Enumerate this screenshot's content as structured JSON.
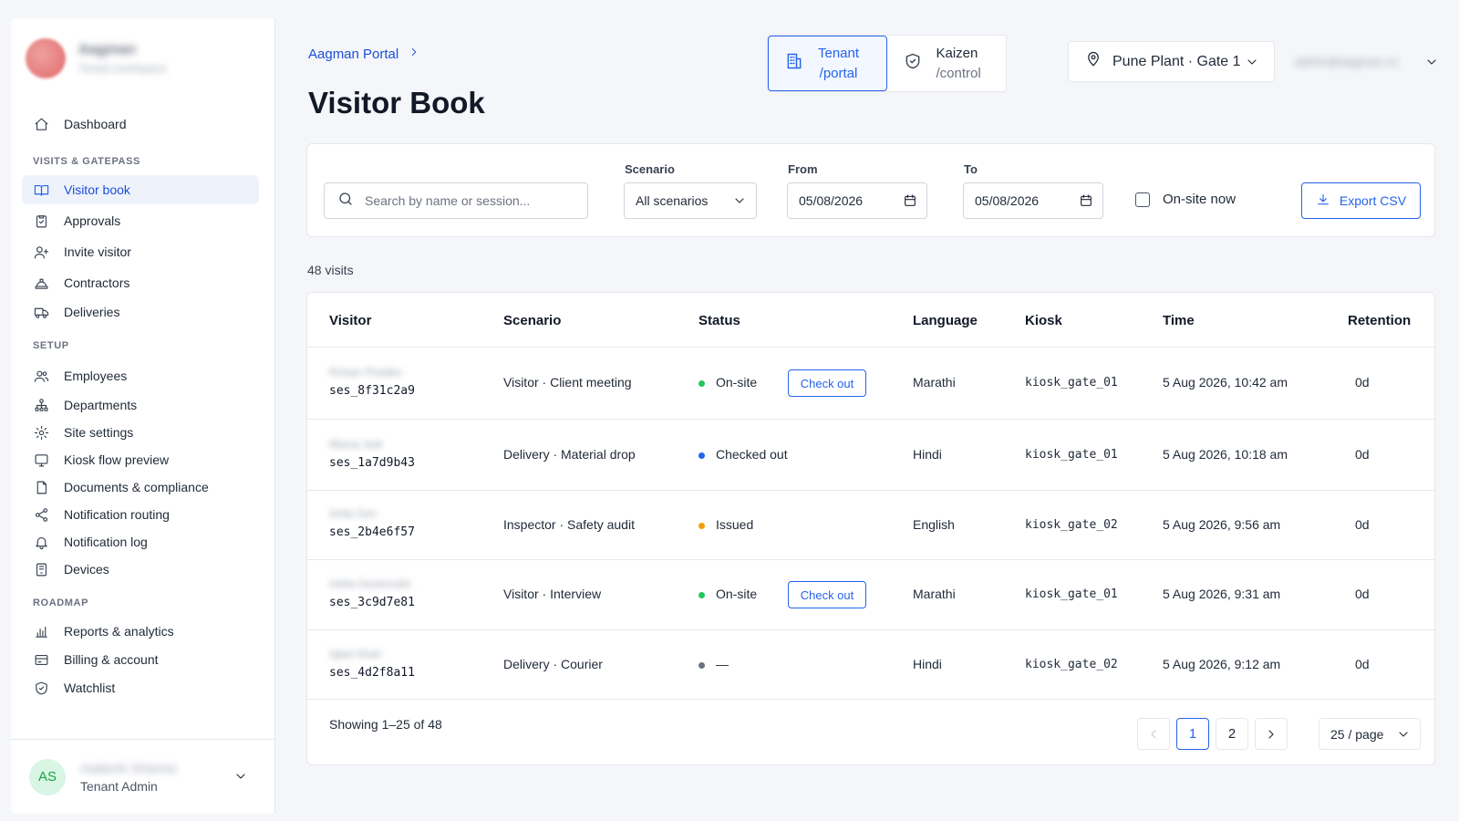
{
  "sidebar": {
    "org_name": "Aagman",
    "org_sub": "Tenant workspace",
    "top_items": [
      {
        "label": "Dashboard"
      }
    ],
    "sections": [
      {
        "title": "VISITS & GATEPASS",
        "items": [
          {
            "label": "Visitor book"
          },
          {
            "label": "Approvals"
          },
          {
            "label": "Invite visitor"
          },
          {
            "label": "Contractors"
          },
          {
            "label": "Deliveries"
          }
        ]
      },
      {
        "title": "SETUP",
        "items": [
          {
            "label": "Employees"
          },
          {
            "label": "Departments"
          },
          {
            "label": "Site settings"
          },
          {
            "label": "Kiosk flow preview"
          },
          {
            "label": "Documents & compliance"
          },
          {
            "label": "Notification routing"
          },
          {
            "label": "Notification log"
          },
          {
            "label": "Devices"
          }
        ]
      },
      {
        "title": "ROADMAP",
        "items": [
          {
            "label": "Reports & analytics"
          },
          {
            "label": "Billing & account"
          },
          {
            "label": "Watchlist"
          }
        ]
      }
    ],
    "user": {
      "initials": "AS",
      "name": "Aadarsh Sharma",
      "role": "Tenant Admin"
    }
  },
  "header": {
    "breadcrumb": "Aagman Portal",
    "title": "Visitor Book",
    "switcher": [
      {
        "label": "Tenant",
        "sub": "/portal",
        "active": true
      },
      {
        "label": "Kaizen",
        "sub": "/control",
        "active": false
      }
    ],
    "site": "Pune Plant · Gate 1",
    "email": "admin@aagman.co"
  },
  "filters": {
    "search_placeholder": "Search by name or session...",
    "scenario_label": "Scenario",
    "scenario_value": "All scenarios",
    "from_label": "From",
    "from_value": "05/08/2026",
    "to_label": "To",
    "to_value": "05/08/2026",
    "onsite_label": "On-site now",
    "export_label": "Export CSV"
  },
  "count_text": "48 visits",
  "table": {
    "columns": [
      "Visitor",
      "Scenario",
      "Status",
      "Language",
      "Kiosk",
      "Time",
      "Retention"
    ],
    "rows": [
      {
        "name": "Rohan Phadke",
        "session": "ses_8f31c2a9",
        "scenario": "Visitor · Client meeting",
        "status": "On-site",
        "status_color": "#22c55e",
        "action": "Check out",
        "language": "Marathi",
        "kiosk": "kiosk_gate_01",
        "time": "5 Aug 2026, 10:42 am",
        "retention": "0d"
      },
      {
        "name": "Manoj Jadi",
        "session": "ses_1a7d9b43",
        "scenario": "Delivery · Material drop",
        "status": "Checked out",
        "status_color": "#2563eb",
        "action": "",
        "language": "Hindi",
        "kiosk": "kiosk_gate_01",
        "time": "5 Aug 2026, 10:18 am",
        "retention": "0d"
      },
      {
        "name": "Anita Sen",
        "session": "ses_2b4e6f57",
        "scenario": "Inspector · Safety audit",
        "status": "Issued",
        "status_color": "#f59e0b",
        "action": "",
        "language": "English",
        "kiosk": "kiosk_gate_02",
        "time": "5 Aug 2026, 9:56 am",
        "retention": "0d"
      },
      {
        "name": "Ishita Deshmukh",
        "session": "ses_3c9d7e81",
        "scenario": "Visitor · Interview",
        "status": "On-site",
        "status_color": "#22c55e",
        "action": "Check out",
        "language": "Marathi",
        "kiosk": "kiosk_gate_01",
        "time": "5 Aug 2026, 9:31 am",
        "retention": "0d"
      },
      {
        "name": "Iqbal Shah",
        "session": "ses_4d2f8a11",
        "scenario": "Delivery · Courier",
        "status": "—",
        "status_color": "#6b7280",
        "action": "",
        "language": "Hindi",
        "kiosk": "kiosk_gate_02",
        "time": "5 Aug 2026, 9:12 am",
        "retention": "0d"
      }
    ]
  },
  "pagination": {
    "showing": "Showing 1–25 of 48",
    "pages": [
      "1",
      "2"
    ],
    "current": "1",
    "per_page": "25 / page"
  },
  "colors": {
    "accent": "#2563eb",
    "onsite": "#22c55e",
    "issued": "#f59e0b"
  }
}
